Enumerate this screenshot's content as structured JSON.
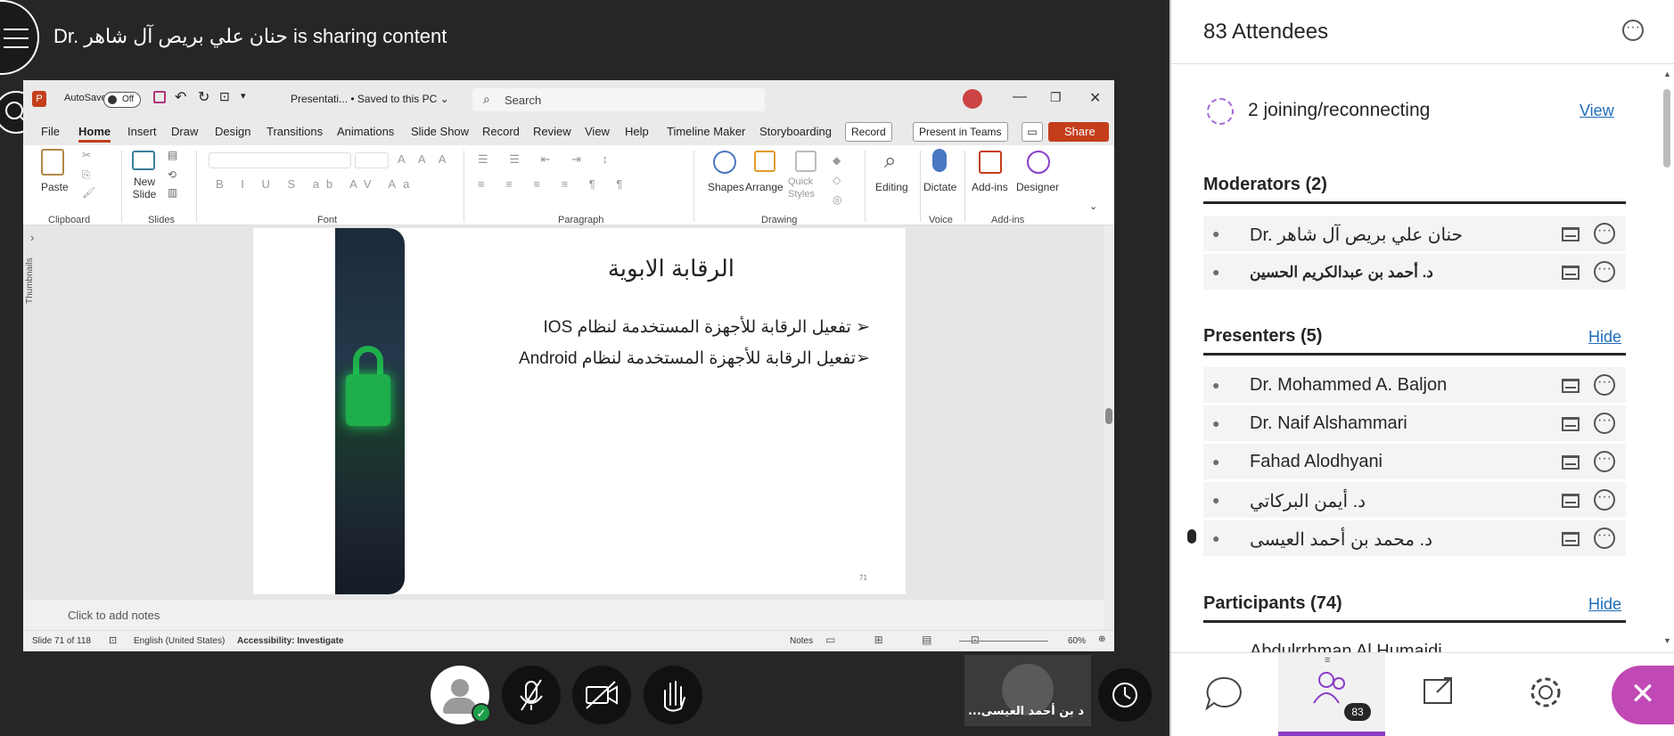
{
  "meeting": {
    "sharing_banner": "Dr. حنان علي بريص آل شاهر is sharing content",
    "self_name": "د بن أحمد العيسى...",
    "controls": {
      "avatar": "user-avatar-icon",
      "mic": "microphone-muted-icon",
      "camera": "camera-off-icon",
      "hand": "raise-hand-icon",
      "timer": "timer-icon"
    }
  },
  "ppt": {
    "autosave_label": "AutoSave",
    "autosave_state": "Off",
    "doc_title": "Presentati... • Saved to this PC ⌄",
    "search_placeholder": "Search",
    "tabs": [
      "File",
      "Home",
      "Insert",
      "Draw",
      "Design",
      "Transitions",
      "Animations",
      "Slide Show",
      "Record",
      "Review",
      "View",
      "Help",
      "Timeline Maker",
      "Storyboarding"
    ],
    "active_tab": "Home",
    "record_btn": "Record",
    "present_teams_btn": "Present in Teams",
    "share_btn": "Share",
    "ribbon": {
      "paste": "Paste",
      "new_slide": "New Slide",
      "shapes": "Shapes",
      "arrange": "Arrange",
      "quick_styles": "Quick Styles",
      "editing": "Editing",
      "dictate": "Dictate",
      "addins": "Add-ins",
      "designer": "Designer",
      "groups": [
        "Clipboard",
        "Slides",
        "Font",
        "Paragraph",
        "Drawing",
        "Voice",
        "Add-ins"
      ]
    },
    "thumbnails_label": "Thumbnails",
    "slide": {
      "title": "الرقابة الابوية",
      "bullets": [
        "➢ تفعيل الرقابة للأجهزة المستخدمة لنظام IOS",
        "➢تفعيل الرقابة للأجهزة المستخدمة لنظام Android"
      ],
      "number": "71"
    },
    "notes_placeholder": "Click to add notes",
    "status": {
      "slide_info": "Slide 71 of 118",
      "language": "English (United States)",
      "accessibility": "Accessibility: Investigate",
      "notes": "Notes",
      "zoom": "60%"
    }
  },
  "panel": {
    "title": "83 Attendees",
    "joining": {
      "label": "2 joining/reconnecting",
      "link": "View"
    },
    "moderators": {
      "title": "Moderators (2)",
      "items": [
        "Dr. حنان علي بريص آل شاهر",
        "د. أحمد بن عبدالكريم الحسين"
      ]
    },
    "presenters": {
      "title": "Presenters (5)",
      "link": "Hide",
      "items": [
        "Dr. Mohammed A. Baljon",
        "Dr. Naif Alshammari",
        "Fahad Alodhyani",
        "د. أيمن البركاتي",
        "د. محمد بن أحمد العيسى"
      ]
    },
    "participants": {
      "title": "Participants (74)",
      "link": "Hide",
      "first_item": "Abdulrrhman Al Humaidi"
    },
    "tabs": {
      "chat": "chat-icon",
      "people": "people-icon",
      "people_count": "83",
      "share": "share-content-icon",
      "settings": "gear-icon"
    }
  }
}
